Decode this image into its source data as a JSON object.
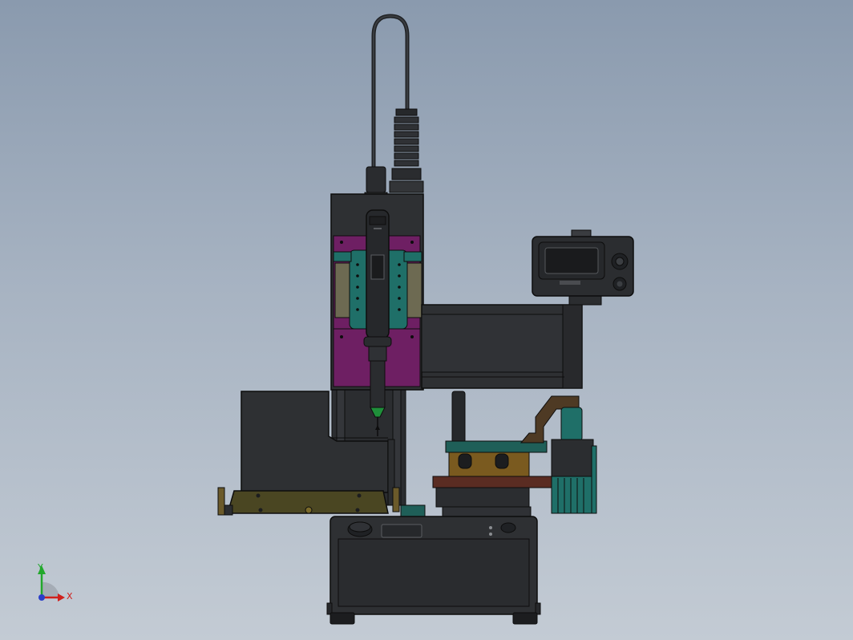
{
  "viewport": {
    "background_top": "#8a9aae",
    "background_bottom": "#c3cbd4"
  },
  "model": {
    "colors": {
      "body": "#2e3033",
      "body_dark": "#1c1d1f",
      "edge": "#0d0d0d",
      "purple": "#6e1f63",
      "teal": "#1f6f68",
      "olive": "#4a4622",
      "brass": "#7a5a1f",
      "maroon": "#5a2c22",
      "green_tip": "#1f8f3a",
      "brown_arm": "#4e3a24"
    },
    "parts": [
      "cable-loop",
      "cable-strain-relief",
      "z-axis-carriage",
      "screwdriver-spindle",
      "x-axis-beam",
      "controller-display",
      "feeder-housing",
      "feeder-base-plate",
      "work-fixture",
      "pneumatic-valve",
      "controller-base"
    ]
  },
  "triad": {
    "x_label": "X",
    "y_label": "Y",
    "x_color": "#d0201c",
    "y_color": "#22a82c",
    "z_color": "#2a3fc9"
  }
}
